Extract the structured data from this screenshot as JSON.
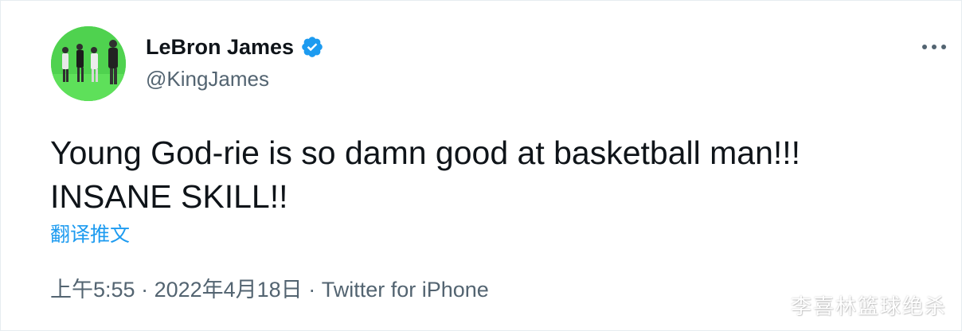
{
  "author": {
    "name": "LeBron James",
    "handle": "@KingJames",
    "verified": true
  },
  "tweet": {
    "lines": [
      "Young God-rie is so damn good at basketball man!!!",
      "INSANE SKILL!!"
    ],
    "translate_label": "翻译推文"
  },
  "meta": {
    "time": "上午5:55",
    "separator": " · ",
    "date": "2022年4月18日",
    "source": "Twitter for iPhone"
  },
  "watermark": "李喜林篮球绝杀",
  "icons": {
    "verified": "verified-badge-icon",
    "more": "more-options-icon"
  },
  "colors": {
    "accent": "#1d9bf0",
    "secondary_text": "#536471",
    "avatar_bg": "#49d14a"
  }
}
